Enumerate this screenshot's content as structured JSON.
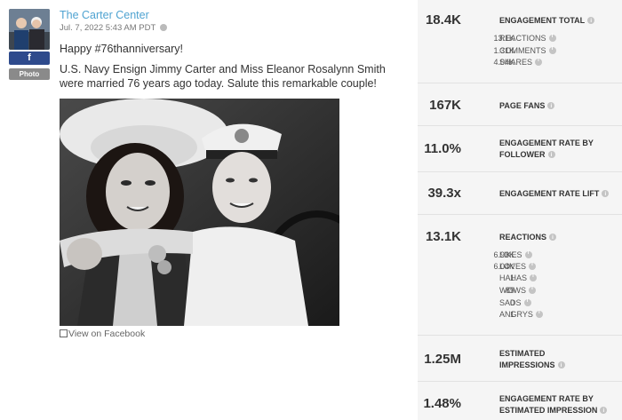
{
  "post": {
    "page_name": "The Carter Center",
    "date": "Jul. 7, 2022 5:43 AM PDT",
    "network_label": "f",
    "type_label": "Photo",
    "text_line1": "Happy #76thanniversary!",
    "text_line2": "U.S. Navy Ensign Jimmy Carter and Miss Eleanor Rosalynn Smith were married 76 years ago today. Salute this remarkable couple!",
    "view_link": "View on Facebook"
  },
  "metrics": {
    "engagement_total": {
      "value": "18.4K",
      "label": "ENGAGEMENT TOTAL"
    },
    "engagement_breakdown": [
      {
        "value": "13.1K",
        "label": "REACTIONS"
      },
      {
        "value": "1.31K",
        "label": "COMMENTS"
      },
      {
        "value": "4.04K",
        "label": "SHARES"
      }
    ],
    "page_fans": {
      "value": "167K",
      "label": "PAGE FANS"
    },
    "engagement_rate_follower": {
      "value": "11.0%",
      "label_line1": "ENGAGEMENT RATE BY",
      "label_line2": "FOLLOWER"
    },
    "engagement_rate_lift": {
      "value": "39.3x",
      "label": "ENGAGEMENT RATE LIFT"
    },
    "reactions": {
      "value": "13.1K",
      "label": "REACTIONS"
    },
    "reaction_breakdown": [
      {
        "value": "6.93K",
        "label": "LIKES"
      },
      {
        "value": "6.04K",
        "label": "LOVES"
      },
      {
        "value": "1",
        "label": "HAHAS"
      },
      {
        "value": "89",
        "label": "WOWS"
      },
      {
        "value": "0",
        "label": "SADS"
      },
      {
        "value": "1",
        "label": "ANGRYS"
      }
    ],
    "estimated_impressions": {
      "value": "1.25M",
      "label_line1": "ESTIMATED",
      "label_line2": "IMPRESSIONS"
    },
    "engagement_rate_impression": {
      "value": "1.48%",
      "label_line1": "ENGAGEMENT RATE BY",
      "label_line2": "ESTIMATED IMPRESSION"
    }
  }
}
